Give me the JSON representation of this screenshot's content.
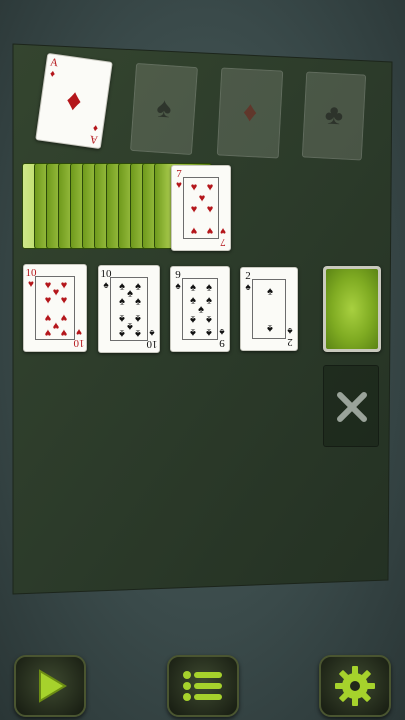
{
  "foundations": [
    {
      "rank": "A",
      "suit": "♦",
      "color": "red",
      "state": "card"
    },
    {
      "rank": "",
      "suit": "♠",
      "color": "black",
      "state": "empty"
    },
    {
      "rank": "",
      "suit": "♦",
      "color": "red",
      "state": "empty"
    },
    {
      "rank": "",
      "suit": "♣",
      "color": "black",
      "state": "empty"
    }
  ],
  "stock_top": {
    "rank": "7",
    "suit": "♥",
    "color": "red"
  },
  "tableau": [
    {
      "rank": "10",
      "suit": "♥",
      "color": "red"
    },
    {
      "rank": "10",
      "suit": "♠",
      "color": "black"
    },
    {
      "rank": "9",
      "suit": "♠",
      "color": "black"
    },
    {
      "rank": "2",
      "suit": "♠",
      "color": "black"
    }
  ],
  "reserve": {
    "state": "face-down"
  },
  "discard_slot": {
    "icon": "x-icon"
  },
  "toolbar": {
    "play": "play-icon",
    "menu": "menu-list-icon",
    "settings": "gear-icon"
  },
  "colors": {
    "accent_green": "#9cc43a",
    "felt": "#2e3d2e",
    "card_red": "#b4161b"
  }
}
